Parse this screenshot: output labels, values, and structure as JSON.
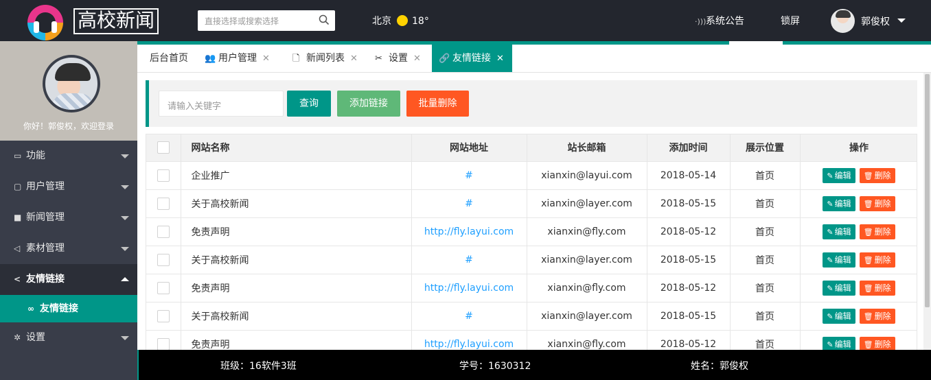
{
  "header": {
    "logo_text": "高校新闻",
    "search_placeholder": "直接选择或搜索选择",
    "weather_city": "北京",
    "weather_temp": "18°",
    "notice_label": "系统公告",
    "lock_label": "锁屏",
    "user_name": "郭俊权"
  },
  "sidebar": {
    "welcome": "你好！郭俊权，欢迎登录",
    "items": [
      {
        "label": "功能",
        "icon": "monitor-icon"
      },
      {
        "label": "用户管理",
        "icon": "chat-icon"
      },
      {
        "label": "新闻管理",
        "icon": "folder-icon"
      },
      {
        "label": "素材管理",
        "icon": "send-icon"
      },
      {
        "label": "友情链接",
        "icon": "share-icon"
      },
      {
        "label": "设置",
        "icon": "gear-icon"
      }
    ],
    "sub_item": {
      "label": "友情链接",
      "icon": "link-icon"
    }
  },
  "tabs": [
    {
      "label": "后台首页"
    },
    {
      "label": "用户管理",
      "icon": "users-icon"
    },
    {
      "label": "新闻列表",
      "icon": "file-icon"
    },
    {
      "label": "设置",
      "icon": "tools-icon"
    },
    {
      "label": "友情链接",
      "icon": "link-icon"
    }
  ],
  "toolbar": {
    "keyword_placeholder": "请输入关键字",
    "query_label": "查询",
    "add_label": "添加链接",
    "batch_delete_label": "批量删除"
  },
  "table": {
    "headers": [
      "网站名称",
      "网站地址",
      "站长邮箱",
      "添加时间",
      "展示位置",
      "操作"
    ],
    "edit_label": "编辑",
    "delete_label": "删除",
    "rows": [
      {
        "name": "企业推广",
        "url": "#",
        "email": "xianxin@layui.com",
        "date": "2018-05-14",
        "position": "首页"
      },
      {
        "name": "关于高校新闻",
        "url": "#",
        "email": "xianxin@layer.com",
        "date": "2018-05-15",
        "position": "首页"
      },
      {
        "name": "免责声明",
        "url": "http://fly.layui.com",
        "email": "xianxin@fly.com",
        "date": "2018-05-12",
        "position": "首页"
      },
      {
        "name": "关于高校新闻",
        "url": "#",
        "email": "xianxin@layer.com",
        "date": "2018-05-15",
        "position": "首页"
      },
      {
        "name": "免责声明",
        "url": "http://fly.layui.com",
        "email": "xianxin@fly.com",
        "date": "2018-05-12",
        "position": "首页"
      },
      {
        "name": "关于高校新闻",
        "url": "#",
        "email": "xianxin@layer.com",
        "date": "2018-05-15",
        "position": "首页"
      },
      {
        "name": "免责声明",
        "url": "http://fly.layui.com",
        "email": "xianxin@fly.com",
        "date": "2018-05-12",
        "position": "首页"
      }
    ]
  },
  "footer": {
    "class_text": "班级：16软件3班",
    "id_text": "学号：1630312",
    "name_text": "姓名：郭俊权"
  },
  "colors": {
    "header_bg": "#23262e",
    "sidebar_bg": "#393d49",
    "accent": "#009688",
    "add_button": "#5fb878",
    "danger": "#ff5722",
    "link": "#1e9fff"
  }
}
